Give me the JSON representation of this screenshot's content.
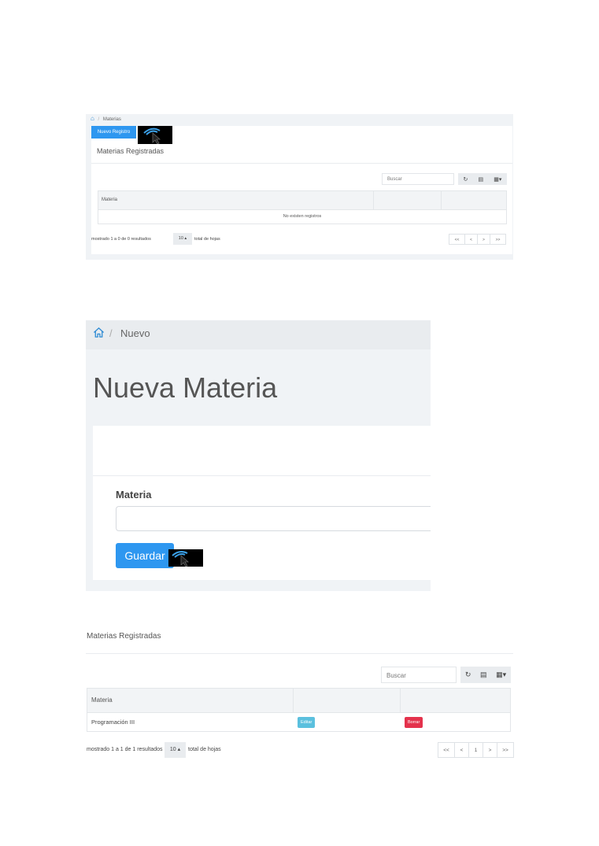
{
  "list_view": {
    "breadcrumb": {
      "icon": "home-icon",
      "separator": "/",
      "current": "Materias"
    },
    "new_button": "Nuevo Registro",
    "card_title": "Materias Registradas",
    "search_placeholder": "Buscar",
    "toolbar_icons": [
      "refresh-icon",
      "toggle-view-icon",
      "columns-icon"
    ],
    "columns": [
      "Materia",
      "",
      ""
    ],
    "empty_message": "No existen registros",
    "footer": {
      "showing": "mostrado 1 a 0 de 0 resultados",
      "page_size": "10 ▴",
      "total_pages": "total de hojas"
    },
    "pager": [
      "<<",
      "<",
      ">",
      ">>"
    ]
  },
  "form_view": {
    "breadcrumb": {
      "icon": "home-icon",
      "separator": "/",
      "current": "Nuevo"
    },
    "page_title": "Nueva Materia",
    "field_label": "Materia",
    "field_value": "",
    "save_button": "Guardar"
  },
  "result_view": {
    "card_title": "Materias Registradas",
    "search_placeholder": "Buscar",
    "toolbar_icons": [
      "refresh-icon",
      "toggle-view-icon",
      "columns-icon"
    ],
    "columns": [
      "Materia",
      "",
      ""
    ],
    "rows": [
      {
        "materia": "Programación III",
        "edit_label": "Editar",
        "delete_label": "Borrar"
      }
    ],
    "footer": {
      "showing": "mostrado 1 a 1 de 1 resultados",
      "page_size": "10 ▴",
      "total_pages": "total de hojas"
    },
    "pager": [
      "<<",
      "<",
      "1",
      ">",
      ">>"
    ]
  },
  "colors": {
    "primary": "#2e97f0",
    "info": "#5bc0de",
    "danger": "#e4324c",
    "panel_bg": "#f0f3f6"
  }
}
